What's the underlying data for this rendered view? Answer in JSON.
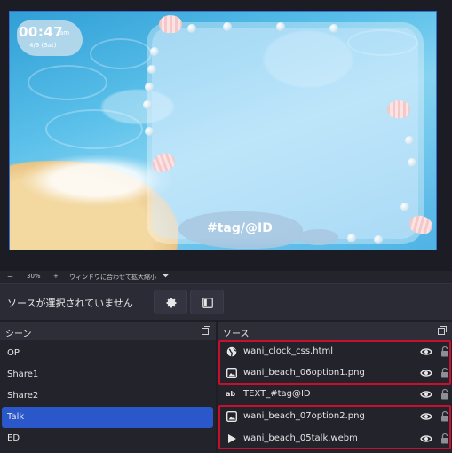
{
  "preview": {
    "clock_time": "00:47",
    "clock_ampm": "am",
    "clock_date": "4/9 (Sat)",
    "tag_text": "#tag/@ID"
  },
  "zoom_bar": {
    "minus": "ー",
    "zoom": "30%",
    "plus": "+",
    "fit_label": "ウィンドウに合わせて拡大縮小"
  },
  "properties_bar": {
    "no_source_label": "ソースが選択されていません",
    "properties_icon": "gear-icon",
    "filters_icon": "filter-icon"
  },
  "scenes": {
    "title": "シーン",
    "items": [
      {
        "label": "OP",
        "active": false
      },
      {
        "label": "Share1",
        "active": false
      },
      {
        "label": "Share2",
        "active": false
      },
      {
        "label": "Talk",
        "active": true
      },
      {
        "label": "ED",
        "active": false
      }
    ]
  },
  "sources": {
    "title": "ソース",
    "items": [
      {
        "label": "wani_clock_css.html",
        "icon": "browser-globe-icon"
      },
      {
        "label": "wani_beach_06option1.png",
        "icon": "image-icon"
      },
      {
        "label": "TEXT_#tag@ID",
        "icon": "text-icon",
        "icon_text": "ab"
      },
      {
        "label": "wani_beach_07option2.png",
        "icon": "image-icon"
      },
      {
        "label": "wani_beach_05talk.webm",
        "icon": "media-play-icon"
      }
    ]
  },
  "colors": {
    "highlight": "#c8102e",
    "active_scene": "#2a57c9",
    "canvas_border": "#3b6fd8"
  }
}
